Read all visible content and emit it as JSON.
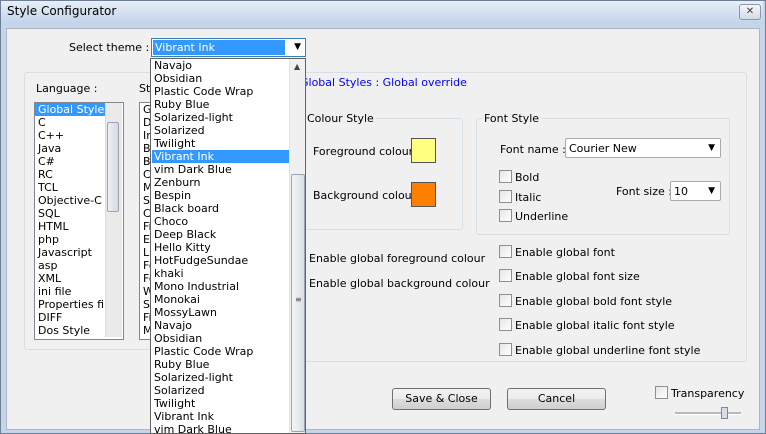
{
  "window": {
    "title": "Style Configurator",
    "close_glyph": "✕"
  },
  "theme": {
    "label": "Select theme :",
    "selected": "Vibrant Ink",
    "dropdown_items": [
      "Navajo",
      "Obsidian",
      "Plastic Code Wrap",
      "Ruby Blue",
      "Solarized-light",
      "Solarized",
      "Twilight",
      "Vibrant Ink",
      "vim Dark Blue",
      "Zenburn",
      "Bespin",
      "Black board",
      "Choco",
      "Deep Black",
      "Hello Kitty",
      "HotFudgeSundae",
      "khaki",
      "Mono Industrial",
      "Monokai",
      "MossyLawn",
      "Navajo",
      "Obsidian",
      "Plastic Code Wrap",
      "Ruby Blue",
      "Solarized-light",
      "Solarized",
      "Twilight",
      "Vibrant Ink",
      "vim Dark Blue"
    ],
    "selected_index": 7
  },
  "language": {
    "label": "Language :",
    "items": [
      "Global Styles",
      "C",
      "C++",
      "Java",
      "C#",
      "RC",
      "TCL",
      "Objective-C",
      "SQL",
      "HTML",
      "php",
      "Javascript",
      "asp",
      "XML",
      "ini file",
      "Properties file",
      "DIFF",
      "Dos Style"
    ],
    "selected_index": 0
  },
  "style": {
    "label": "Sty",
    "visible_prefixes": [
      "Gl",
      "De",
      "In",
      "Br",
      "Ba",
      "Cu",
      "M",
      "Se",
      "Ca",
      "Fi",
      "Ed",
      "Li",
      "Fo",
      "Fo",
      "W",
      "Sm",
      "Fi",
      "M"
    ]
  },
  "description": "Global Styles : Global override",
  "colour_style": {
    "label": "Colour Style",
    "foreground_label": "Foreground colour",
    "background_label": "Background colour",
    "foreground_color": "#ffff80",
    "background_color": "#ff8000"
  },
  "font_style": {
    "label": "Font Style",
    "font_name_label": "Font name :",
    "font_name_value": "Courier New",
    "font_size_label": "Font size :",
    "font_size_value": "10",
    "bold_label": "Bold",
    "italic_label": "Italic",
    "underline_label": "Underline"
  },
  "global_options": {
    "fg": "Enable global foreground colour",
    "bg": "Enable global background colour",
    "font": "Enable global font",
    "size": "Enable global font size",
    "bold": "Enable global bold font style",
    "italic": "Enable global italic font style",
    "underline": "Enable global underline font style"
  },
  "buttons": {
    "save": "Save & Close",
    "cancel": "Cancel"
  },
  "transparency_label": "Transparency"
}
